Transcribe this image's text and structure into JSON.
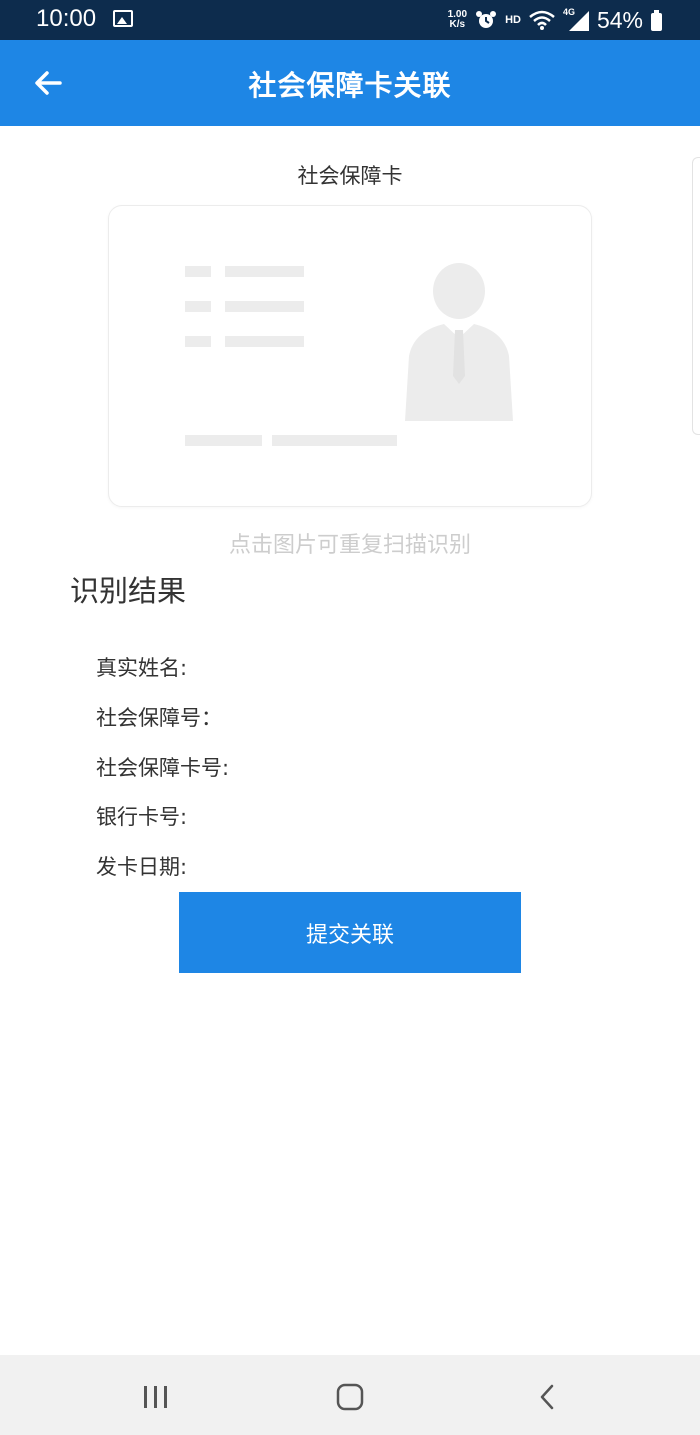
{
  "status_bar": {
    "time": "10:00",
    "speed_value": "1.00",
    "speed_unit": "K/s",
    "hd": "HD",
    "network": "4G",
    "battery": "54%"
  },
  "app_bar": {
    "title": "社会保障卡关联"
  },
  "card": {
    "caption": "社会保障卡",
    "scan_hint": "点击图片可重复扫描识别"
  },
  "result": {
    "heading": "识别结果",
    "fields": [
      {
        "label": "真实姓名:"
      },
      {
        "label": "社会保障号："
      },
      {
        "label": "社会保障卡号:"
      },
      {
        "label": "银行卡号:"
      },
      {
        "label": "发卡日期:"
      }
    ]
  },
  "actions": {
    "submit_label": "提交关联"
  },
  "colors": {
    "primary": "#1e86e5",
    "status_bar": "#0d2c4d",
    "placeholder_gray": "#ececec"
  },
  "icons": {
    "back": "arrow-left-icon",
    "recents": "recent-apps-icon",
    "home": "home-icon",
    "nav_back": "chevron-left-icon"
  }
}
